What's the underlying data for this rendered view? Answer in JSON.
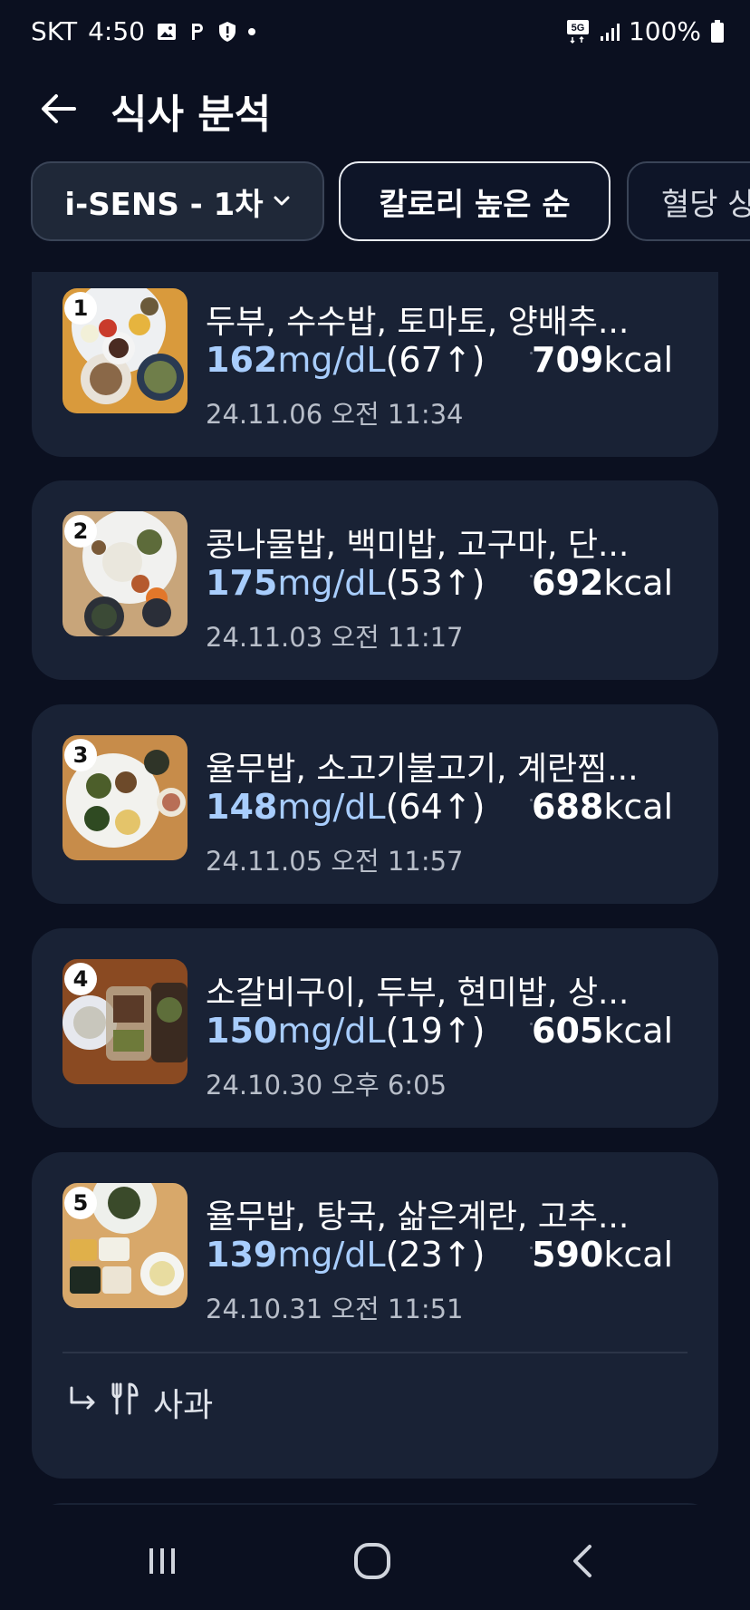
{
  "status_bar": {
    "carrier": "SKT",
    "time": "4:50",
    "battery": "100%",
    "network": "5G"
  },
  "header": {
    "title": "식사 분석"
  },
  "filters": {
    "device": "i-SENS - 1차",
    "sort": "칼로리 높은 순",
    "third": "혈당 상"
  },
  "meals": [
    {
      "rank": "1",
      "name": "두부, 수수밥, 토마토, 양배추...",
      "glucose": "162",
      "glucose_unit": "mg/dL",
      "delta": "(67↑)",
      "kcal": "709",
      "kcal_unit": "kcal",
      "date": "24.11.06 오전 11:34"
    },
    {
      "rank": "2",
      "name": "콩나물밥, 백미밥, 고구마, 단...",
      "glucose": "175",
      "glucose_unit": "mg/dL",
      "delta": "(53↑)",
      "kcal": "692",
      "kcal_unit": "kcal",
      "date": "24.11.03 오전 11:17"
    },
    {
      "rank": "3",
      "name": "율무밥, 소고기불고기, 계란찜...",
      "glucose": "148",
      "glucose_unit": "mg/dL",
      "delta": "(64↑)",
      "kcal": "688",
      "kcal_unit": "kcal",
      "date": "24.11.05 오전 11:57"
    },
    {
      "rank": "4",
      "name": "소갈비구이, 두부, 현미밥, 상...",
      "glucose": "150",
      "glucose_unit": "mg/dL",
      "delta": "(19↑)",
      "kcal": "605",
      "kcal_unit": "kcal",
      "date": "24.10.30 오후 6:05"
    },
    {
      "rank": "5",
      "name": "율무밥, 탕국, 삶은계란, 고추...",
      "glucose": "139",
      "glucose_unit": "mg/dL",
      "delta": "(23↑)",
      "kcal": "590",
      "kcal_unit": "kcal",
      "date": "24.10.31 오전 11:51",
      "sub_item": "사과"
    }
  ],
  "colors": {
    "background": "#0b1020",
    "card": "#192235",
    "glucose": "#a8cdfc"
  }
}
